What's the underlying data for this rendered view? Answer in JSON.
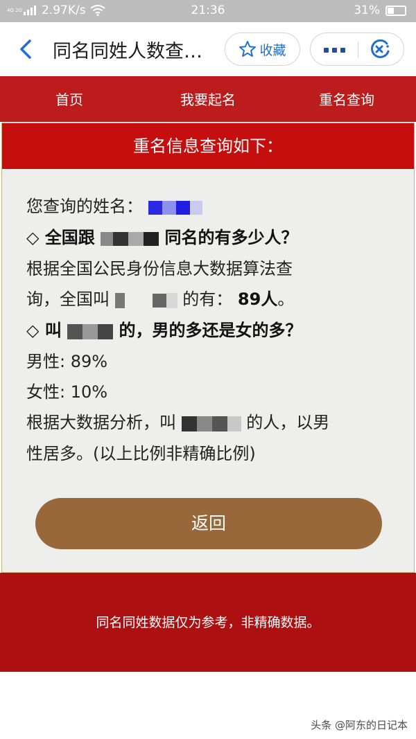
{
  "status_bar": {
    "network": "4G 2G",
    "speed": "2.97K/s",
    "time": "21:36",
    "battery": "31%"
  },
  "header": {
    "title": "同名同姓人数查…",
    "favorite_label": "收藏",
    "icons": [
      "back-icon",
      "star-icon",
      "more-icon",
      "close-icon"
    ],
    "accent_color": "#1e6fd0"
  },
  "nav": {
    "items": [
      "首页",
      "我要起名",
      "重名查询"
    ],
    "background": "#bd1c1c"
  },
  "result_panel": {
    "heading": "重名信息查询如下：",
    "query_label": "您查询的姓名：",
    "question1_prefix": "◇ 全国跟",
    "question1_suffix": "同名的有多少人？",
    "answer1_line1": "根据全国公民身份信息大数据算法查",
    "answer1_line2_prefix": "询，全国叫",
    "answer1_line2_suffix": "的有：",
    "count": "89人",
    "question2_prefix": "◇ 叫",
    "question2_suffix": "的，男的多还是女的多？",
    "male": "男性: 89%",
    "female": "女性: 10%",
    "analysis_line1_prefix": "根据大数据分析，叫",
    "analysis_line1_suffix": "的人，以男",
    "analysis_line2": "性居多。(以上比例非精确比例)",
    "back_button": "返回",
    "button_color": "#98673a"
  },
  "footer": {
    "note": "同名同姓数据仅为参考，非精确数据。",
    "background": "#ac1010"
  },
  "watermark": "头条 @阿东的日记本"
}
